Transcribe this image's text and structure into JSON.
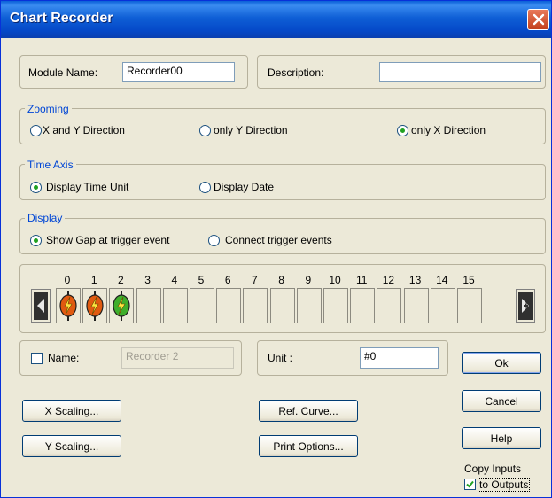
{
  "window": {
    "title": "Chart Recorder"
  },
  "module": {
    "name_label": "Module Name:",
    "name_value": "Recorder00",
    "description_label": "Description:",
    "description_value": ""
  },
  "zooming": {
    "title": "Zooming",
    "options": [
      "X and Y Direction",
      "only Y Direction",
      "only X Direction"
    ],
    "selected": "only X Direction"
  },
  "time_axis": {
    "title": "Time Axis",
    "options": [
      "Display Time Unit",
      "Display Date"
    ],
    "selected": "Display Time Unit"
  },
  "display": {
    "title": "Display",
    "options": [
      "Show Gap at trigger event",
      "Connect trigger events"
    ],
    "selected": "Show Gap at trigger event"
  },
  "channels": {
    "numbers": [
      "0",
      "1",
      "2",
      "3",
      "4",
      "5",
      "6",
      "7",
      "8",
      "9",
      "10",
      "11",
      "12",
      "13",
      "14",
      "15"
    ],
    "active_colors": [
      "#e05a10",
      "#e05a10",
      "#3fae2a"
    ]
  },
  "name_row": {
    "checkbox_label": "Name:",
    "checked": false,
    "name_value": "Recorder 2",
    "unit_label": "Unit :",
    "unit_value": "#0"
  },
  "buttons": {
    "ok": "Ok",
    "cancel": "Cancel",
    "help": "Help",
    "x_scaling": "X Scaling...",
    "y_scaling": "Y Scaling...",
    "ref_curve": "Ref. Curve...",
    "print_options": "Print Options..."
  },
  "copy": {
    "line1": "Copy Inputs",
    "line2": "to Outputs",
    "checked": true
  }
}
